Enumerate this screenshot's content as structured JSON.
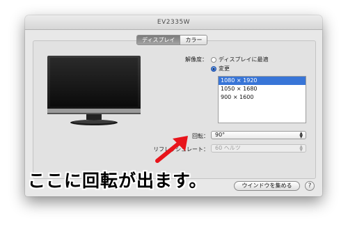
{
  "window": {
    "title": "EV2335W"
  },
  "tabs": [
    {
      "label": "ディスプレイ",
      "active": true
    },
    {
      "label": "カラー",
      "active": false
    }
  ],
  "resolution": {
    "label": "解像度：",
    "options": [
      {
        "label": "ディスプレイに最適",
        "selected": false
      },
      {
        "label": "変更",
        "selected": true
      }
    ],
    "list": [
      "1080 × 1920",
      "1050 × 1680",
      "900 × 1600"
    ],
    "selected_item": "1080 × 1920"
  },
  "rotation": {
    "label": "回転：",
    "value": "90°"
  },
  "refresh_rate": {
    "label": "リフレッシュレート：",
    "value": "60 ヘルツ"
  },
  "buttons": {
    "gather_windows": "ウインドウを集める",
    "help": "?"
  },
  "annotation": {
    "caption": "ここに回転が出ます。"
  },
  "colors": {
    "selection": "#3875d7",
    "annotation_arrow": "#e8141b"
  },
  "icons": {
    "monitor": "display-monitor-icon",
    "arrow": "red-arrow-icon"
  }
}
